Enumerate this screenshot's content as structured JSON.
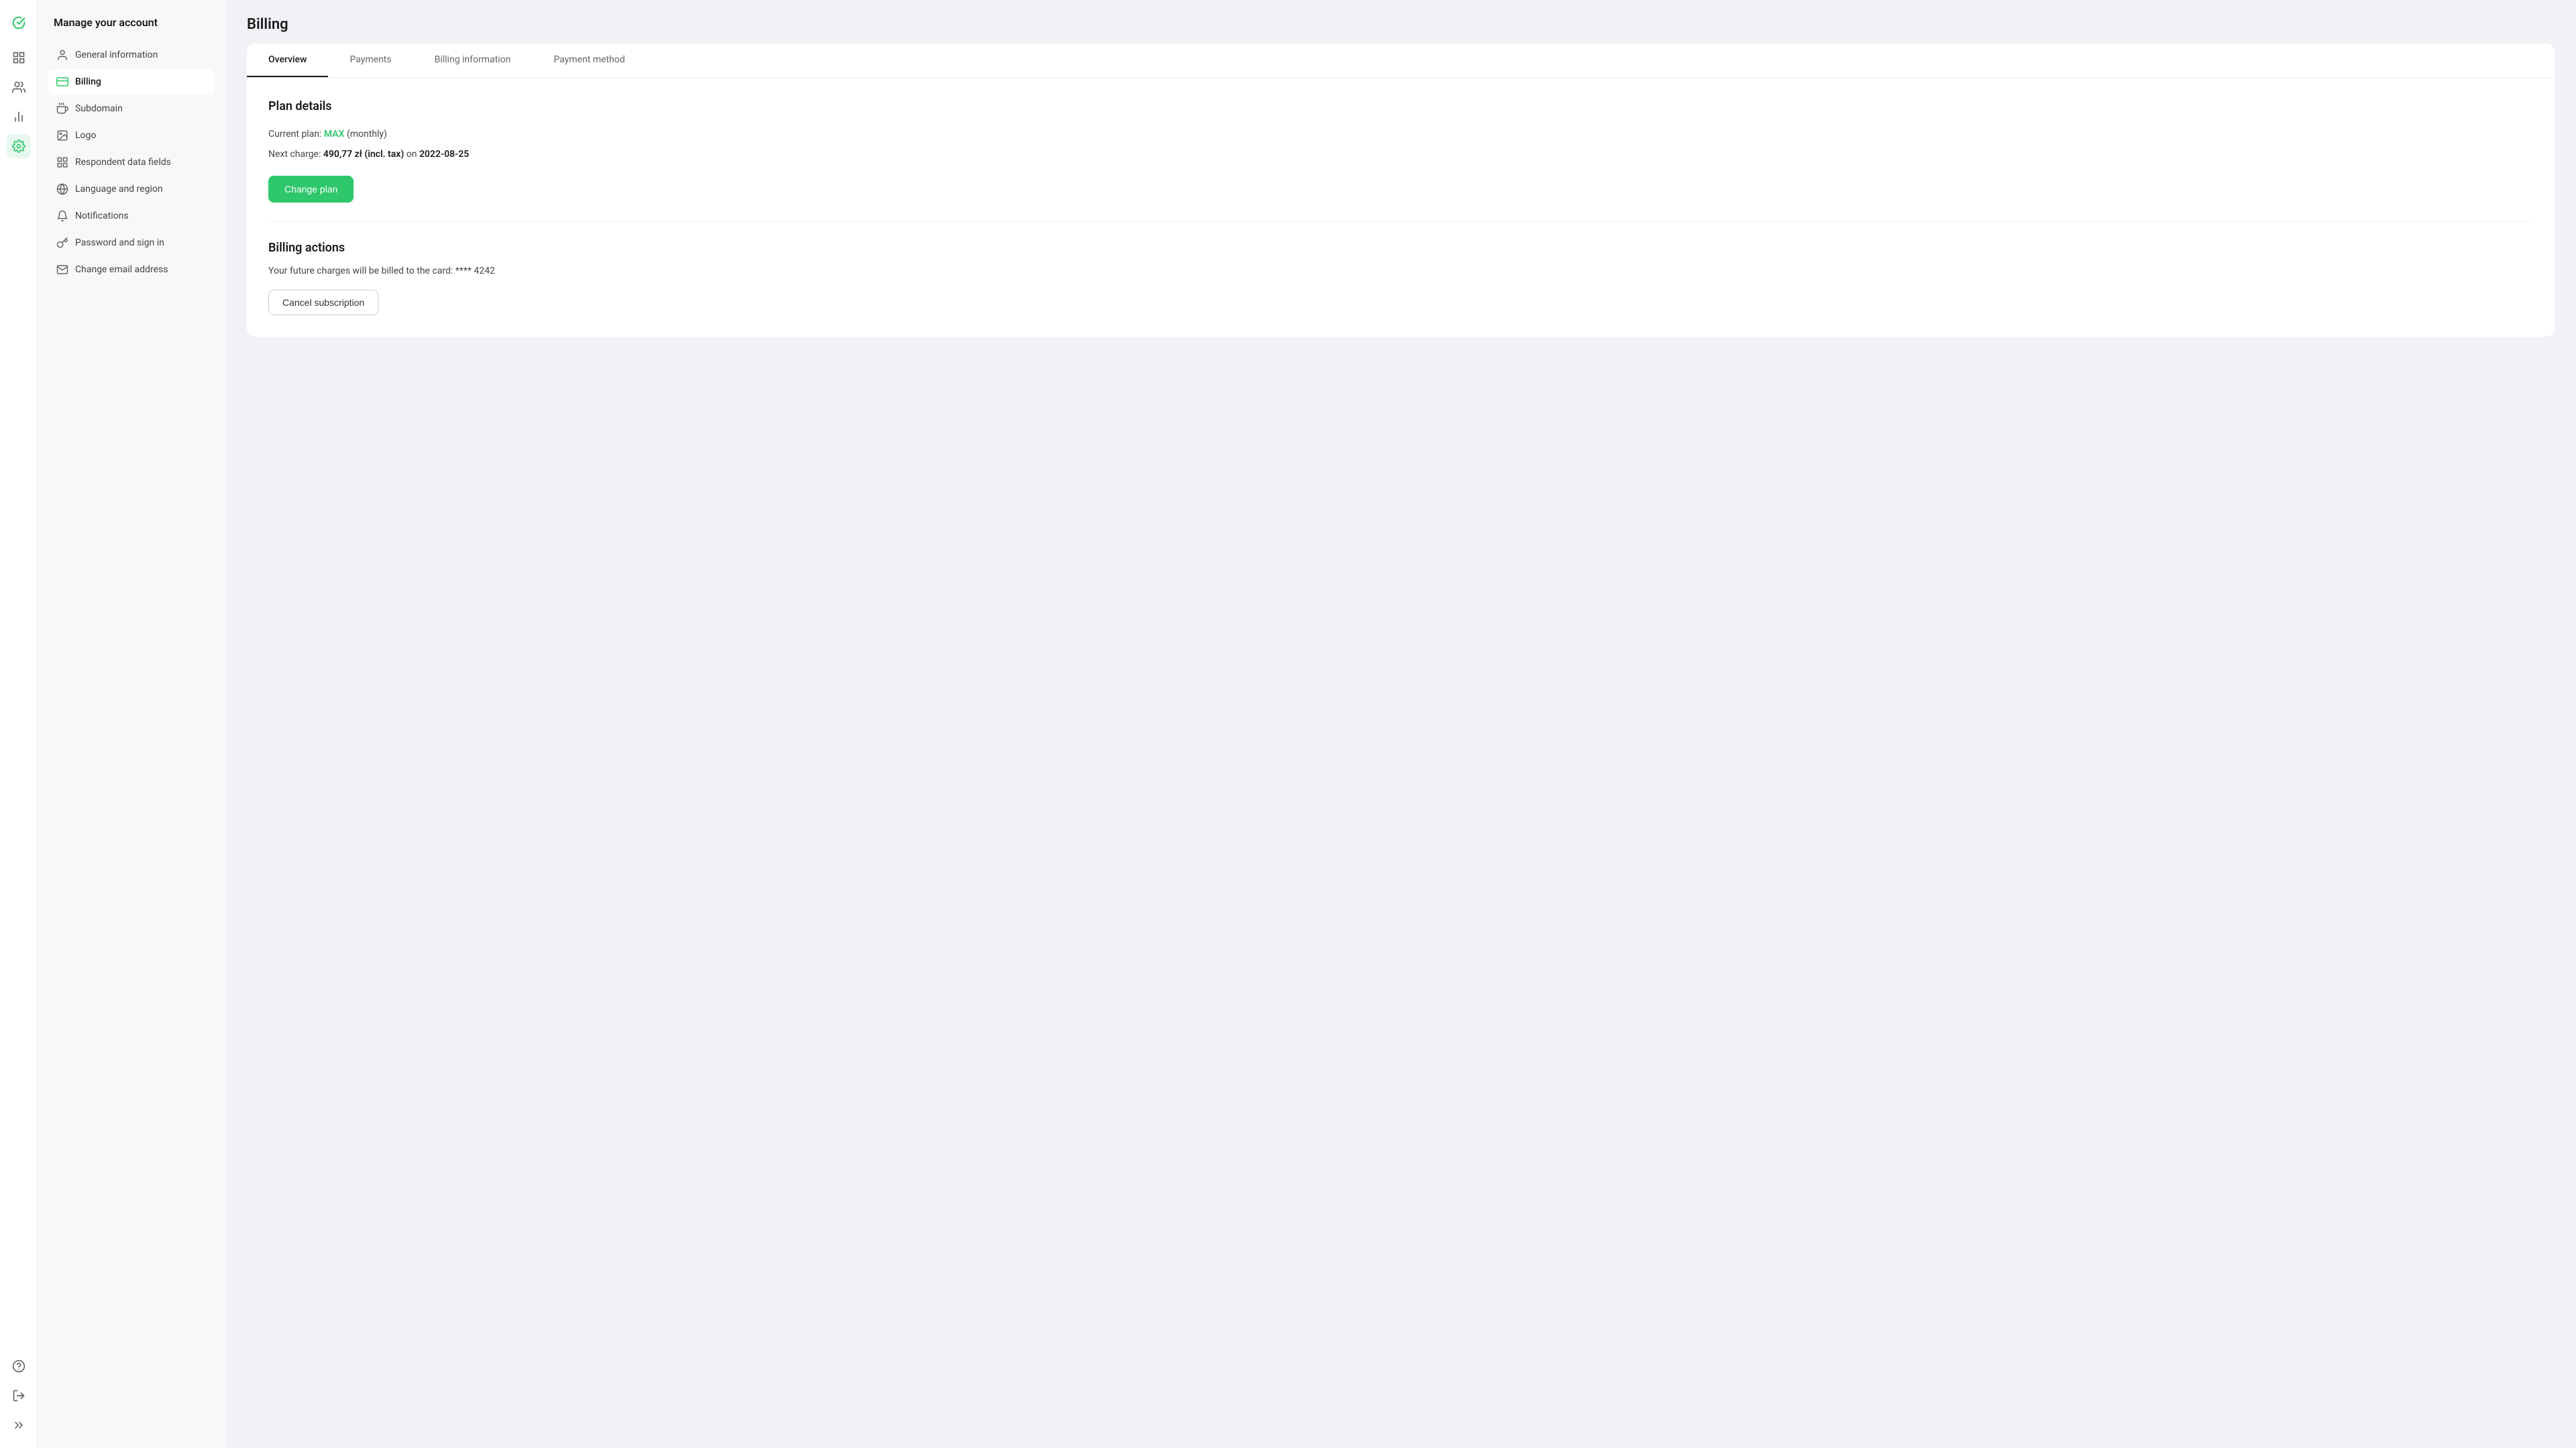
{
  "app": {
    "logo_icon": "check-circle-icon",
    "logo_color": "#2ec76b"
  },
  "icon_bar": {
    "top": [
      {
        "name": "logo-icon",
        "icon": "check"
      },
      {
        "name": "grid-icon",
        "icon": "grid"
      },
      {
        "name": "users-icon",
        "icon": "users"
      },
      {
        "name": "chart-icon",
        "icon": "chart"
      },
      {
        "name": "settings-icon",
        "icon": "settings",
        "active": true
      }
    ],
    "bottom": [
      {
        "name": "help-icon",
        "icon": "help"
      },
      {
        "name": "logout-icon",
        "icon": "logout"
      },
      {
        "name": "collapse-icon",
        "icon": "collapse"
      }
    ]
  },
  "sidebar": {
    "title": "Manage your account",
    "items": [
      {
        "id": "general",
        "label": "General information",
        "icon": "user-circle"
      },
      {
        "id": "billing",
        "label": "Billing",
        "icon": "credit-card",
        "active": true
      },
      {
        "id": "subdomain",
        "label": "Subdomain",
        "icon": "bell-subdomain"
      },
      {
        "id": "logo",
        "label": "Logo",
        "icon": "image"
      },
      {
        "id": "respondent",
        "label": "Respondent data fields",
        "icon": "grid-small"
      },
      {
        "id": "language",
        "label": "Language and region",
        "icon": "globe"
      },
      {
        "id": "notifications",
        "label": "Notifications",
        "icon": "bell"
      },
      {
        "id": "password",
        "label": "Password and sign in",
        "icon": "key"
      },
      {
        "id": "email",
        "label": "Change email address",
        "icon": "envelope"
      }
    ]
  },
  "main": {
    "title": "Billing",
    "tabs": [
      {
        "id": "overview",
        "label": "Overview",
        "active": true
      },
      {
        "id": "payments",
        "label": "Payments"
      },
      {
        "id": "billing-info",
        "label": "Billing information"
      },
      {
        "id": "payment-method",
        "label": "Payment method"
      }
    ],
    "plan_details": {
      "section_title": "Plan details",
      "current_plan_prefix": "Current plan: ",
      "plan_name": "MAX",
      "plan_suffix": " (monthly)",
      "next_charge_prefix": "Next charge: ",
      "next_charge_amount": "490,77 zł (incl. tax)",
      "next_charge_on": " on ",
      "next_charge_date": "2022-08-25",
      "change_plan_label": "Change plan"
    },
    "billing_actions": {
      "section_title": "Billing actions",
      "card_text_prefix": "Your future charges will be billed to the card: ",
      "card_number": "**** 4242",
      "cancel_label": "Cancel subscription"
    }
  }
}
